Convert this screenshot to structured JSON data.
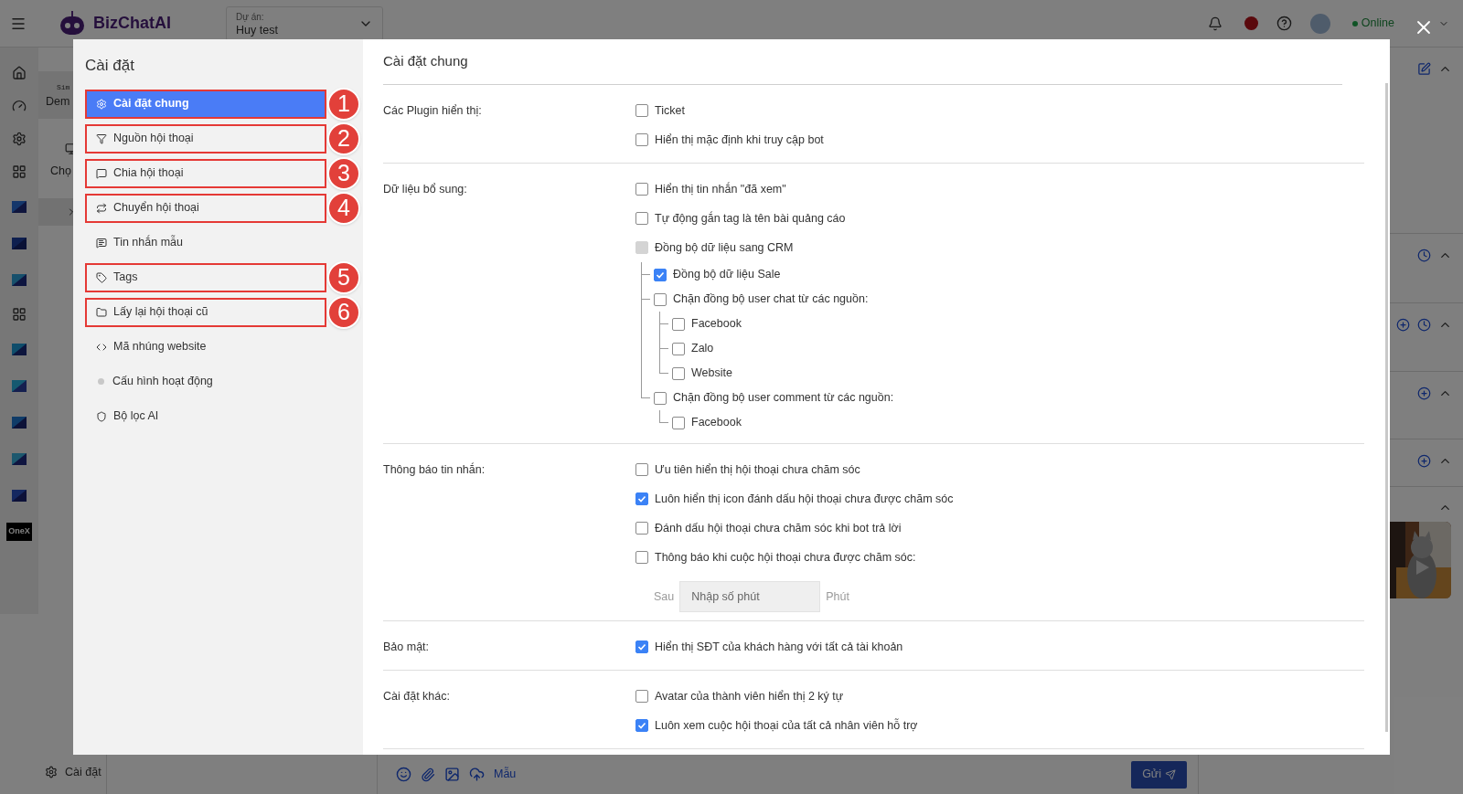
{
  "header": {
    "logo": "BizChatAI",
    "project_label": "Dự án:",
    "project_value": "Huy test",
    "status": "Online"
  },
  "background_list": {
    "tag": "Sim",
    "title": "Dem",
    "action": "Chọ"
  },
  "rail_logo": "OneX",
  "footer": {
    "settings": "Cài đặt",
    "template": "Mẫu",
    "send": "Gửi"
  },
  "modal": {
    "title": "Cài đặt",
    "content_title": "Cài đặt chung",
    "nav": [
      {
        "label": "Cài đặt chung",
        "selected": true,
        "badge": "1"
      },
      {
        "label": "Nguồn hội thoại",
        "selected": false,
        "badge": "2"
      },
      {
        "label": "Chia hội thoại",
        "selected": false,
        "badge": "3"
      },
      {
        "label": "Chuyển hội thoại",
        "selected": false,
        "badge": "4"
      },
      {
        "label": "Tin nhắn mẫu",
        "selected": false
      },
      {
        "label": "Tags",
        "selected": false,
        "badge": "5"
      },
      {
        "label": "Lấy lại hội thoại cũ",
        "selected": false,
        "badge": "6"
      },
      {
        "label": "Mã nhúng website",
        "selected": false
      },
      {
        "label": "Cấu hình hoạt động",
        "selected": false
      },
      {
        "label": "Bộ lọc AI",
        "selected": false
      }
    ],
    "sections": [
      {
        "label": "Các Plugin hiển thị:",
        "options": [
          {
            "kind": "checkbox",
            "label": "Ticket",
            "checked": false,
            "disabled": false
          },
          {
            "kind": "checkbox",
            "label": "Hiển thị mặc định khi truy cập bot",
            "checked": false,
            "disabled": false
          }
        ]
      },
      {
        "label": "Dữ liệu bổ sung:",
        "options": [
          {
            "kind": "checkbox",
            "label": "Hiển thị tin nhắn \"đã xem\"",
            "checked": false,
            "disabled": false
          },
          {
            "kind": "checkbox",
            "label": "Tự động gắn tag là tên bài quảng cáo",
            "checked": false,
            "disabled": false
          },
          {
            "kind": "checkbox",
            "label": "Đồng bộ dữ liệu sang CRM",
            "checked": false,
            "disabled": true,
            "children": [
              {
                "kind": "checkbox",
                "label": "Đồng bộ dữ liệu Sale",
                "checked": true,
                "disabled": false
              },
              {
                "kind": "checkbox",
                "label": "Chặn đồng bộ user chat từ các nguồn:",
                "checked": false,
                "disabled": false,
                "children": [
                  {
                    "kind": "checkbox",
                    "label": "Facebook",
                    "checked": false,
                    "disabled": false
                  },
                  {
                    "kind": "checkbox",
                    "label": "Zalo",
                    "checked": false,
                    "disabled": false
                  },
                  {
                    "kind": "checkbox",
                    "label": "Website",
                    "checked": false,
                    "disabled": false
                  }
                ]
              },
              {
                "kind": "checkbox",
                "label": "Chặn đồng bộ user comment từ các nguồn:",
                "checked": false,
                "disabled": false,
                "children": [
                  {
                    "kind": "checkbox",
                    "label": "Facebook",
                    "checked": false,
                    "disabled": false
                  }
                ]
              }
            ]
          }
        ]
      },
      {
        "label": "Thông báo tin nhắn:",
        "options": [
          {
            "kind": "checkbox",
            "label": "Ưu tiên hiển thị hội thoại chưa chăm sóc",
            "checked": false,
            "disabled": false
          },
          {
            "kind": "checkbox",
            "label": "Luôn hiển thị icon đánh dấu hội thoại chưa được chăm sóc",
            "checked": true,
            "disabled": false
          },
          {
            "kind": "checkbox",
            "label": "Đánh dấu hội thoại chưa chăm sóc khi bot trả lời",
            "checked": false,
            "disabled": false
          },
          {
            "kind": "checkbox",
            "label": "Thông báo khi cuộc hội thoại chưa được chăm sóc:",
            "checked": false,
            "disabled": false
          },
          {
            "kind": "minutes",
            "prefix": "Sau",
            "placeholder": "Nhập số phút",
            "suffix": "Phút"
          }
        ]
      },
      {
        "label": "Bảo mật:",
        "options": [
          {
            "kind": "checkbox",
            "label": "Hiển thị SĐT của khách hàng với tất cả tài khoản",
            "checked": true,
            "disabled": false
          }
        ]
      },
      {
        "label": "Cài đặt khác:",
        "options": [
          {
            "kind": "checkbox",
            "label": "Avatar của thành viên hiển thị 2 ký tự",
            "checked": false,
            "disabled": false
          },
          {
            "kind": "checkbox",
            "label": "Luôn xem cuộc hội thoại của tất cả nhân viên hỗ trợ",
            "checked": true,
            "disabled": false
          }
        ]
      }
    ]
  }
}
